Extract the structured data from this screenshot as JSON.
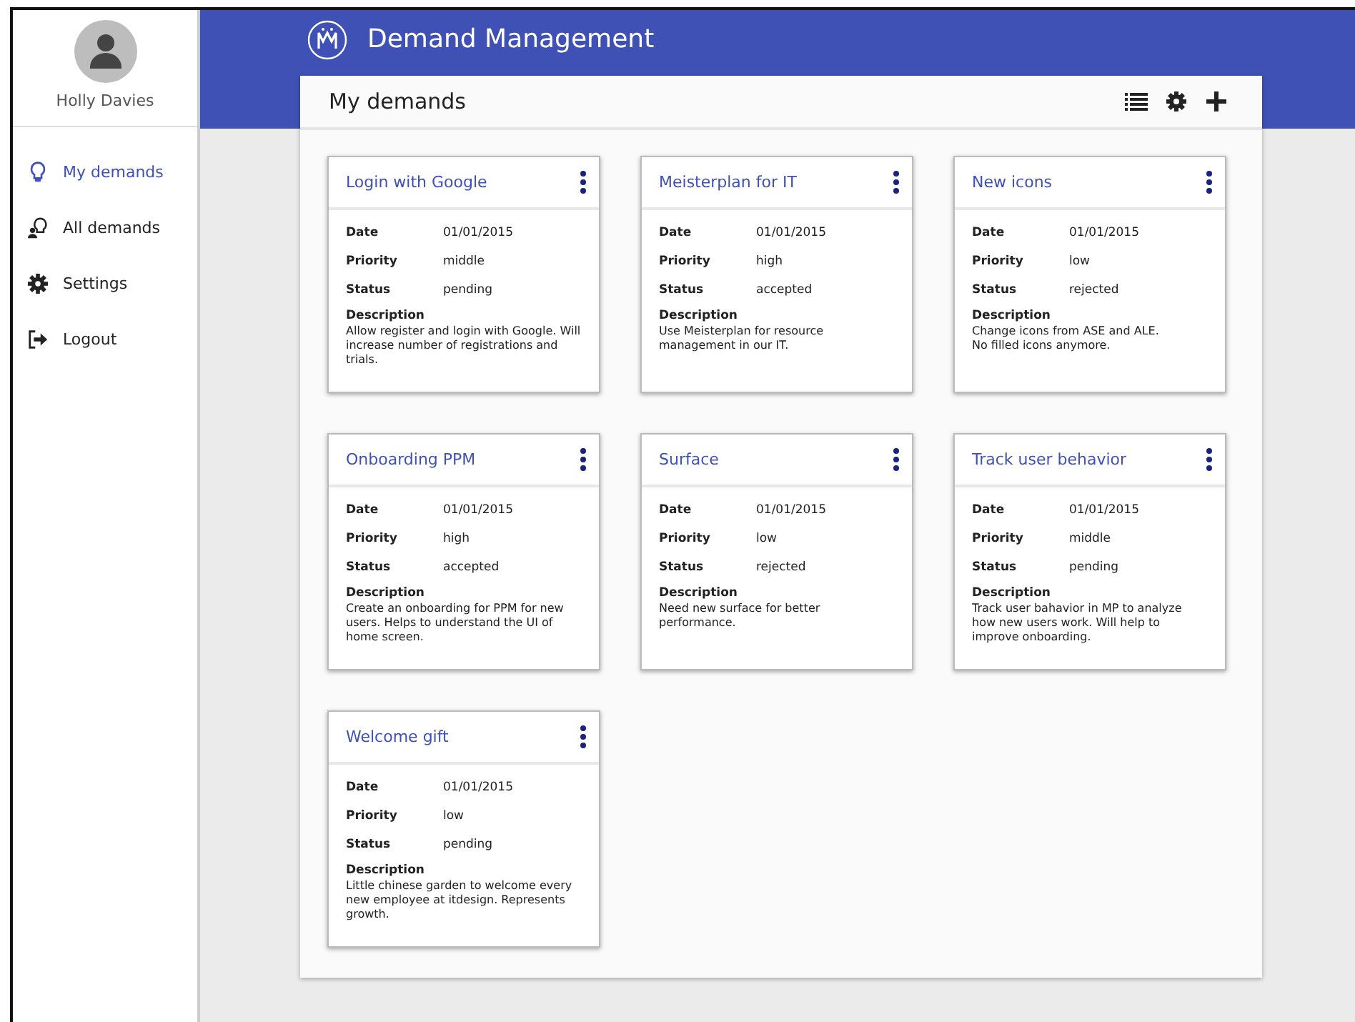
{
  "user": {
    "name": "Holly Davies"
  },
  "nav": [
    {
      "label": "My demands",
      "selected": true
    },
    {
      "label": "All demands",
      "selected": false
    },
    {
      "label": "Settings",
      "selected": false
    },
    {
      "label": "Logout",
      "selected": false
    }
  ],
  "header": {
    "title": "Demand Management"
  },
  "panel": {
    "title": "My demands"
  },
  "cards": [
    {
      "title": "Login with Google",
      "fields": [
        {
          "label": "Date",
          "value": "01/01/2015"
        },
        {
          "label": "Priority",
          "value": "middle"
        },
        {
          "label": "Status",
          "value": "pending"
        }
      ],
      "description_label": "Description",
      "description": "Allow register and login with Google. Will increase number of registrations and trials."
    },
    {
      "title": "Meisterplan for IT",
      "fields": [
        {
          "label": "Date",
          "value": "01/01/2015"
        },
        {
          "label": "Priority",
          "value": "high"
        },
        {
          "label": "Status",
          "value": "accepted"
        }
      ],
      "description_label": "Description",
      "description": "Use Meisterplan for resource management in our IT."
    },
    {
      "title": "New icons",
      "fields": [
        {
          "label": "Date",
          "value": "01/01/2015"
        },
        {
          "label": "Priority",
          "value": "low"
        },
        {
          "label": "Status",
          "value": "rejected"
        }
      ],
      "description_label": "Description",
      "description": "Change icons from ASE and ALE.\nNo filled icons anymore."
    },
    {
      "title": "Onboarding PPM",
      "fields": [
        {
          "label": "Date",
          "value": "01/01/2015"
        },
        {
          "label": "Priority",
          "value": "high"
        },
        {
          "label": "Status",
          "value": "accepted"
        }
      ],
      "description_label": "Description",
      "description": "Create an onboarding for PPM for new users. Helps to understand the UI of home screen."
    },
    {
      "title": "Surface",
      "fields": [
        {
          "label": "Date",
          "value": "01/01/2015"
        },
        {
          "label": "Priority",
          "value": "low"
        },
        {
          "label": "Status",
          "value": "rejected"
        }
      ],
      "description_label": "Description",
      "description": "Need new surface for better performance."
    },
    {
      "title": "Track user behavior",
      "fields": [
        {
          "label": "Date",
          "value": "01/01/2015"
        },
        {
          "label": "Priority",
          "value": "middle"
        },
        {
          "label": "Status",
          "value": "pending"
        }
      ],
      "description_label": "Description",
      "description": "Track user bahavior in MP to analyze how new users work. Will help to improve onboarding."
    },
    {
      "title": "Welcome gift",
      "fields": [
        {
          "label": "Date",
          "value": "01/01/2015"
        },
        {
          "label": "Priority",
          "value": "low"
        },
        {
          "label": "Status",
          "value": "pending"
        }
      ],
      "description_label": "Description",
      "description": "Little chinese garden to welcome every new employee at itdesign. Represents growth."
    }
  ]
}
